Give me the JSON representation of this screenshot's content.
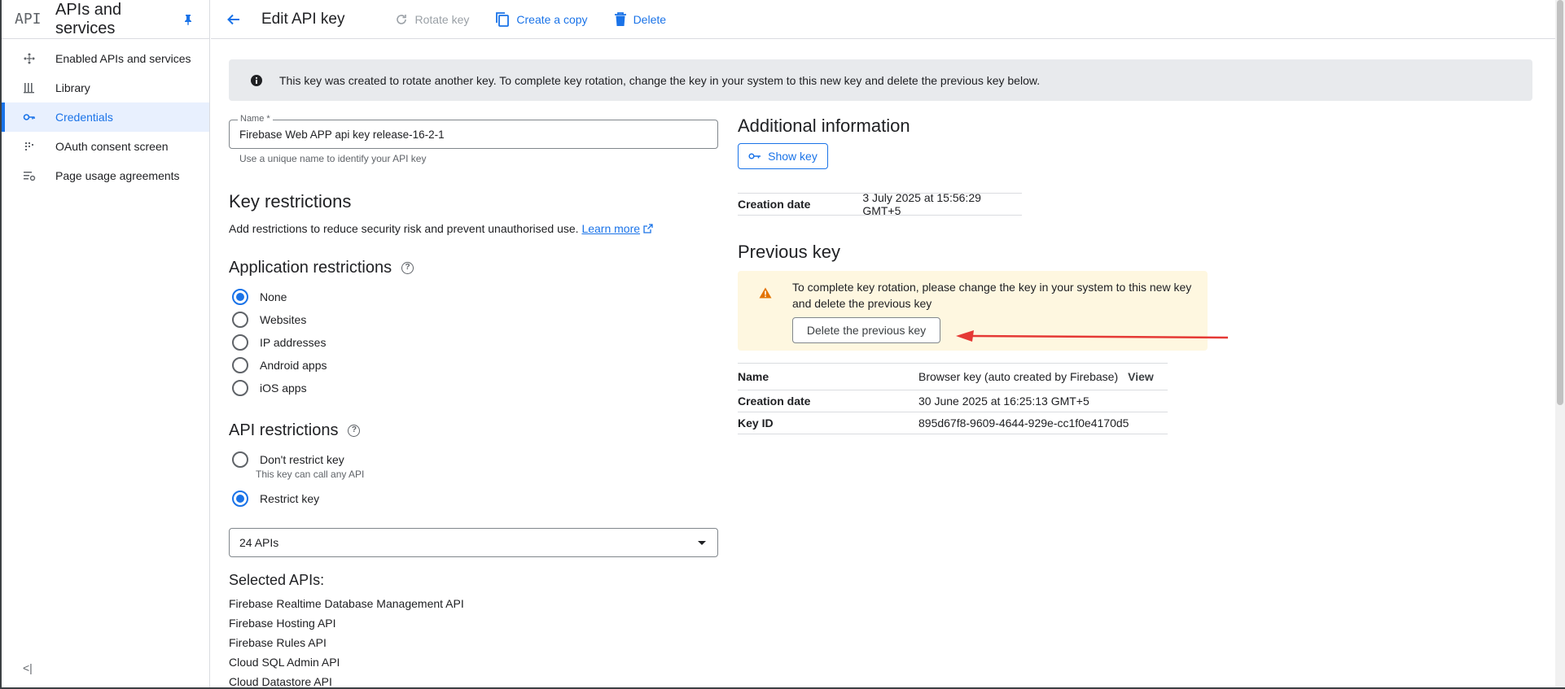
{
  "sidebar": {
    "logo": "API",
    "title": "APIs and services",
    "items": [
      {
        "label": "Enabled APIs and services",
        "icon": "apis-icon"
      },
      {
        "label": "Library",
        "icon": "library-icon"
      },
      {
        "label": "Credentials",
        "icon": "key-icon",
        "active": true
      },
      {
        "label": "OAuth consent screen",
        "icon": "consent-icon"
      },
      {
        "label": "Page usage agreements",
        "icon": "agreements-icon"
      }
    ],
    "collapse": "<|"
  },
  "toolbar": {
    "title": "Edit API key",
    "rotate_label": "Rotate key",
    "copy_label": "Create a copy",
    "delete_label": "Delete"
  },
  "banner": {
    "text": "This key was created to rotate another key. To complete key rotation, change the key in your system to this new key and delete the previous key below."
  },
  "name_field": {
    "label": "Name *",
    "value": "Firebase Web APP api key release-16-2-1",
    "hint": "Use a unique name to identify your API key"
  },
  "key_restrictions": {
    "title": "Key restrictions",
    "desc": "Add restrictions to reduce security risk and prevent unauthorised use.",
    "learn_more": "Learn more"
  },
  "app_restrictions": {
    "title": "Application restrictions",
    "options": [
      "None",
      "Websites",
      "IP addresses",
      "Android apps",
      "iOS apps"
    ],
    "selected": "None"
  },
  "api_restrictions": {
    "title": "API restrictions",
    "dont_restrict": "Don't restrict key",
    "dont_restrict_hint": "This key can call any API",
    "restrict": "Restrict key",
    "selected": "Restrict key",
    "dropdown_value": "24 APIs"
  },
  "selected_apis": {
    "title": "Selected APIs:",
    "items": [
      "Firebase Realtime Database Management API",
      "Firebase Hosting API",
      "Firebase Rules API",
      "Cloud SQL Admin API",
      "Cloud Datastore API"
    ]
  },
  "additional_info": {
    "title": "Additional information",
    "show_key": "Show key",
    "creation_date_label": "Creation date",
    "creation_date": "3 July 2025 at 15:56:29 GMT+5"
  },
  "previous_key": {
    "title": "Previous key",
    "warning": "To complete key rotation, please change the key in your system to this new key and delete the previous key",
    "delete_button": "Delete the previous key",
    "name_label": "Name",
    "name_value": "Browser key (auto created by Firebase)",
    "view_label": "View",
    "creation_date_label": "Creation date",
    "creation_date": "30 June 2025 at 16:25:13 GMT+5",
    "key_id_label": "Key ID",
    "key_id": "895d67f8-9609-4644-929e-cc1f0e4170d5"
  },
  "colors": {
    "accent": "#1a73e8",
    "warning_bg": "#fef7e0",
    "warning_icon": "#e37400",
    "annotation_arrow": "#e53935"
  }
}
